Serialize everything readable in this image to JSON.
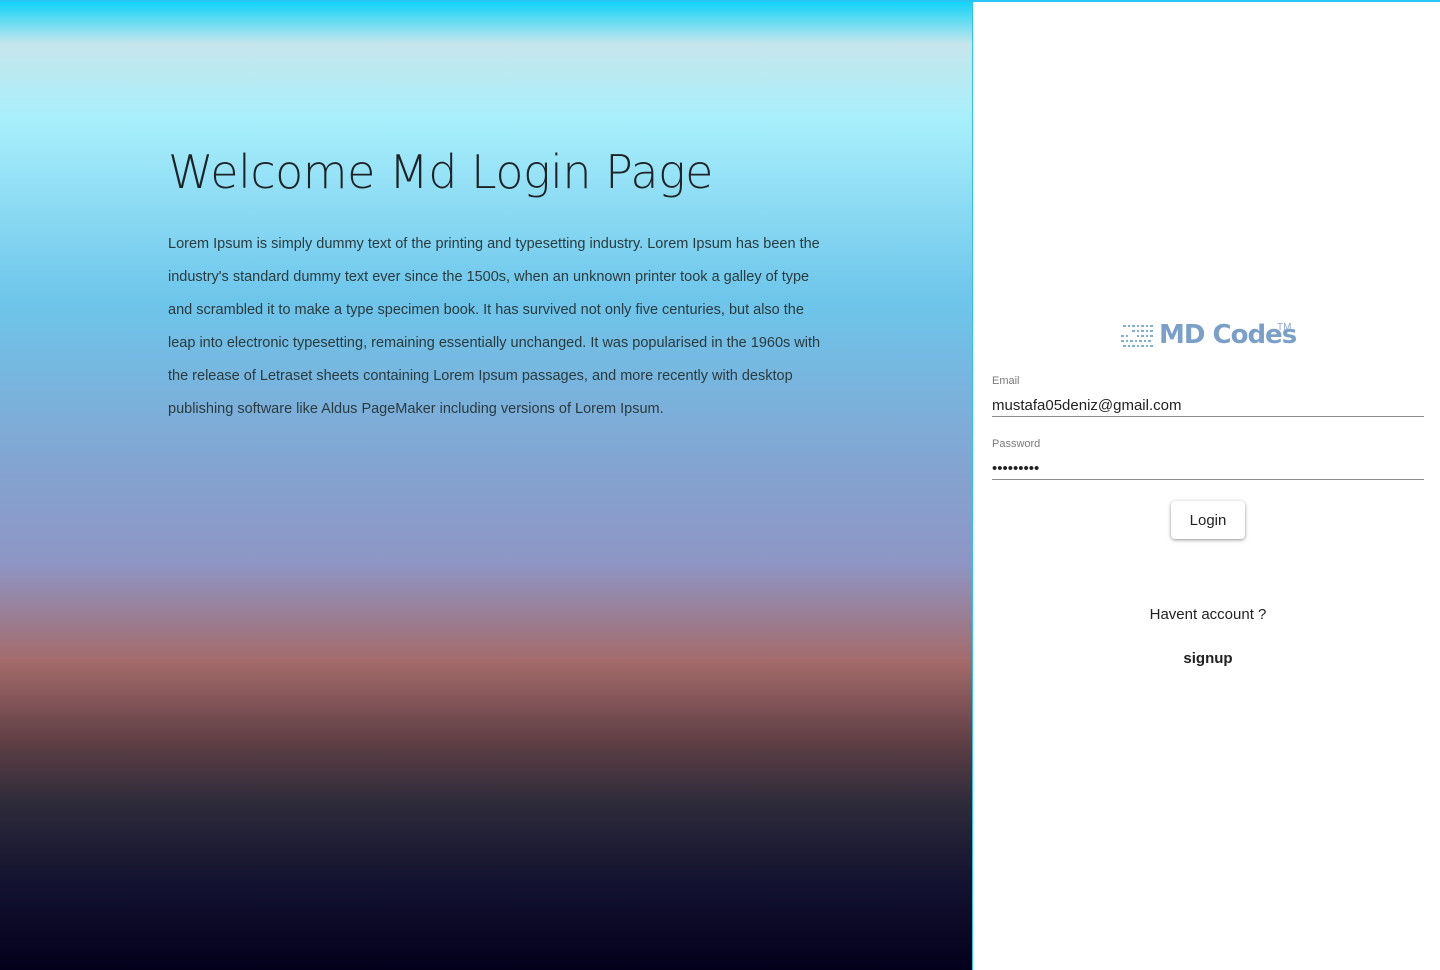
{
  "hero": {
    "title": "Welcome Md Login Page",
    "description": "Lorem Ipsum is simply dummy text of the printing and typesetting industry. Lorem Ipsum has been the industry's standard dummy text ever since the 1500s, when an unknown printer took a galley of type and scrambled it to make a type specimen book. It has survived not only five centuries, but also the leap into electronic typesetting, remaining essentially unchanged. It was popularised in the 1960s with the release of Letraset sheets containing Lorem Ipsum passages, and more recently with desktop publishing software like Aldus PageMaker including versions of Lorem Ipsum."
  },
  "logo": {
    "text": "MD Codes",
    "trademark": "TM",
    "icon": "binary-code-icon",
    "color": "#7a9fc9"
  },
  "form": {
    "email_label": "Email",
    "email_value": "mustafa05deniz@gmail.com",
    "password_label": "Password",
    "password_value": "•••••••••",
    "login_label": "Login"
  },
  "footer": {
    "prompt": "Havent account ?",
    "signup_label": "signup"
  },
  "colors": {
    "accent_border": "#29c5f6",
    "gradient_top": "#a8effc",
    "gradient_mid": "#a46a6a",
    "gradient_bottom": "#03001c"
  }
}
